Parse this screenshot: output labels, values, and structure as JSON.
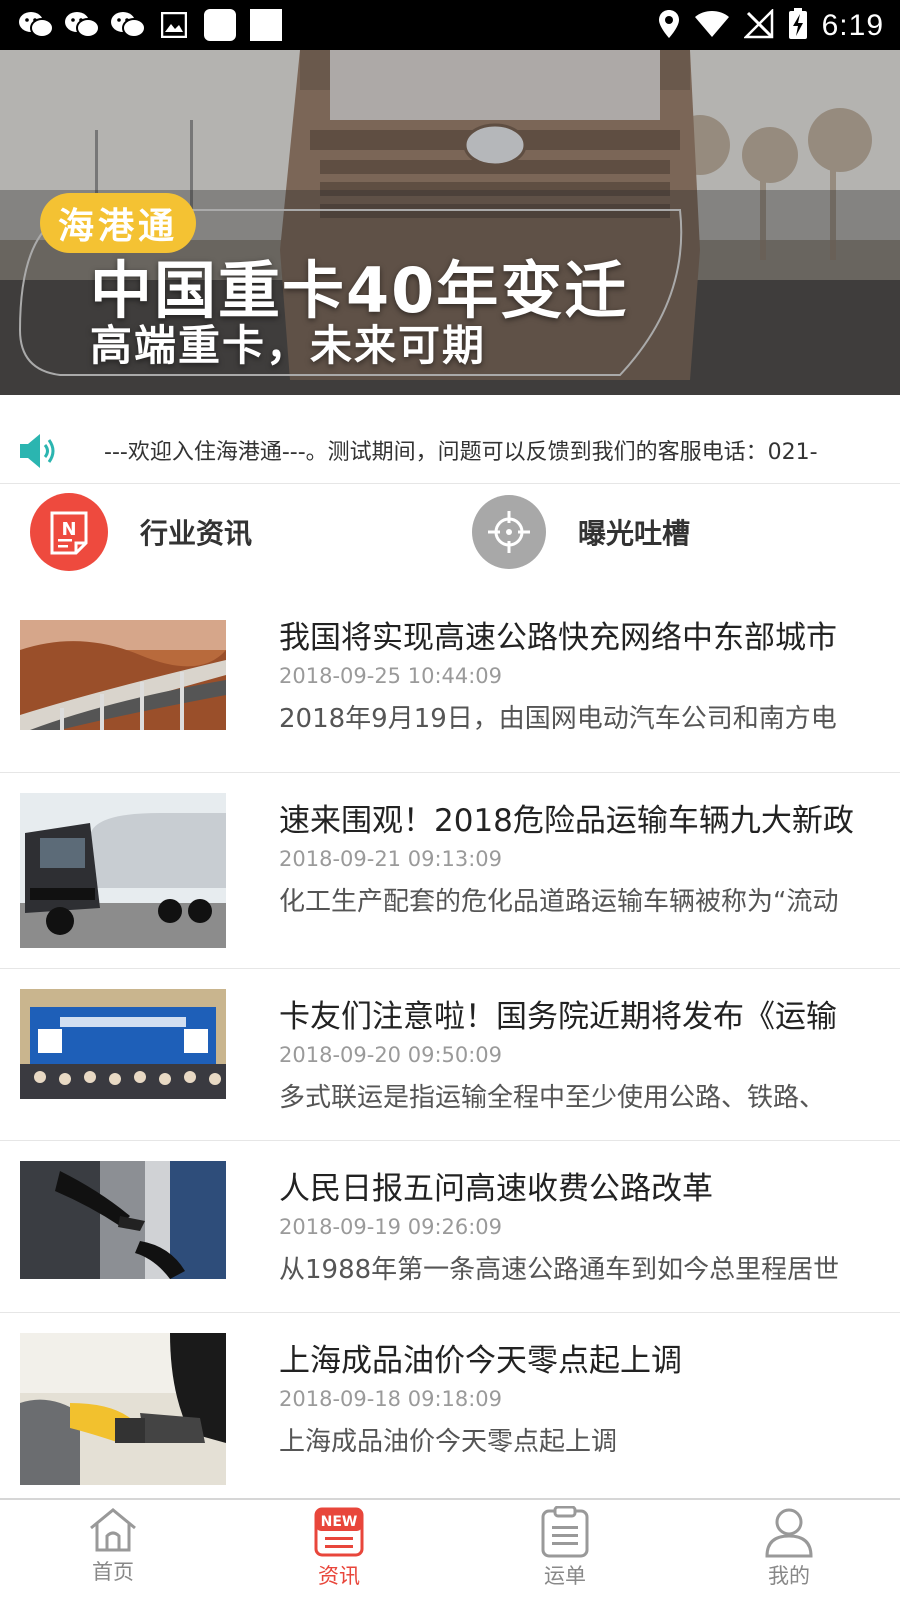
{
  "status_bar": {
    "time": "6:19",
    "left_icons": [
      "wechat-icon",
      "wechat-icon",
      "wechat-icon",
      "image-icon",
      "blank-notification-icon",
      "blank-notification-icon"
    ],
    "right_icons": [
      "location-icon",
      "wifi-icon",
      "no-signal-icon",
      "battery-charging-icon"
    ]
  },
  "banner": {
    "badge": "海港通",
    "title": "中国重卡40年变迁",
    "subtitle": "高端重卡，未来可期",
    "dots": 2
  },
  "notice": {
    "icon": "speaker-icon",
    "text": "---欢迎入住海港通---。测试期间，问题可以反馈到我们的客服电话：021-"
  },
  "categories": [
    {
      "label": "行业资讯",
      "icon": "news-icon",
      "color": "#ee4a3e"
    },
    {
      "label": "曝光吐槽",
      "icon": "target-icon",
      "color": "#a8a8a8"
    }
  ],
  "news": [
    {
      "title": "我国将实现高速公路快充网络中东部城市",
      "date": "2018-09-25 10:44:09",
      "desc": "2018年9月19日，由国网电动汽车公司和南方电"
    },
    {
      "title": "速来围观！2018危险品运输车辆九大新政",
      "date": "2018-09-21 09:13:09",
      "desc": "化工生产配套的危化品道路运输车辆被称为“流动"
    },
    {
      "title": "卡友们注意啦！国务院近期将发布《运输",
      "date": "2018-09-20 09:50:09",
      "desc": "多式联运是指运输全程中至少使用公路、铁路、"
    },
    {
      "title": "人民日报五问高速收费公路改革",
      "date": "2018-09-19 09:26:09",
      "desc": "从1988年第一条高速公路通车到如今总里程居世"
    },
    {
      "title": "上海成品油价今天零点起上调",
      "date": "2018-09-18 09:18:09",
      "desc": "上海成品油价今天零点起上调"
    }
  ],
  "tabs": [
    {
      "label": "首页",
      "icon": "home-icon",
      "active": false
    },
    {
      "label": "资讯",
      "icon": "new-badge-icon",
      "active": true
    },
    {
      "label": "运单",
      "icon": "clipboard-icon",
      "active": false
    },
    {
      "label": "我的",
      "icon": "user-icon",
      "active": false
    }
  ],
  "colors": {
    "accent": "#e8463b",
    "badge_yellow": "#f4c233",
    "notice_teal": "#2bb5b0",
    "inactive_gray": "#888888"
  }
}
